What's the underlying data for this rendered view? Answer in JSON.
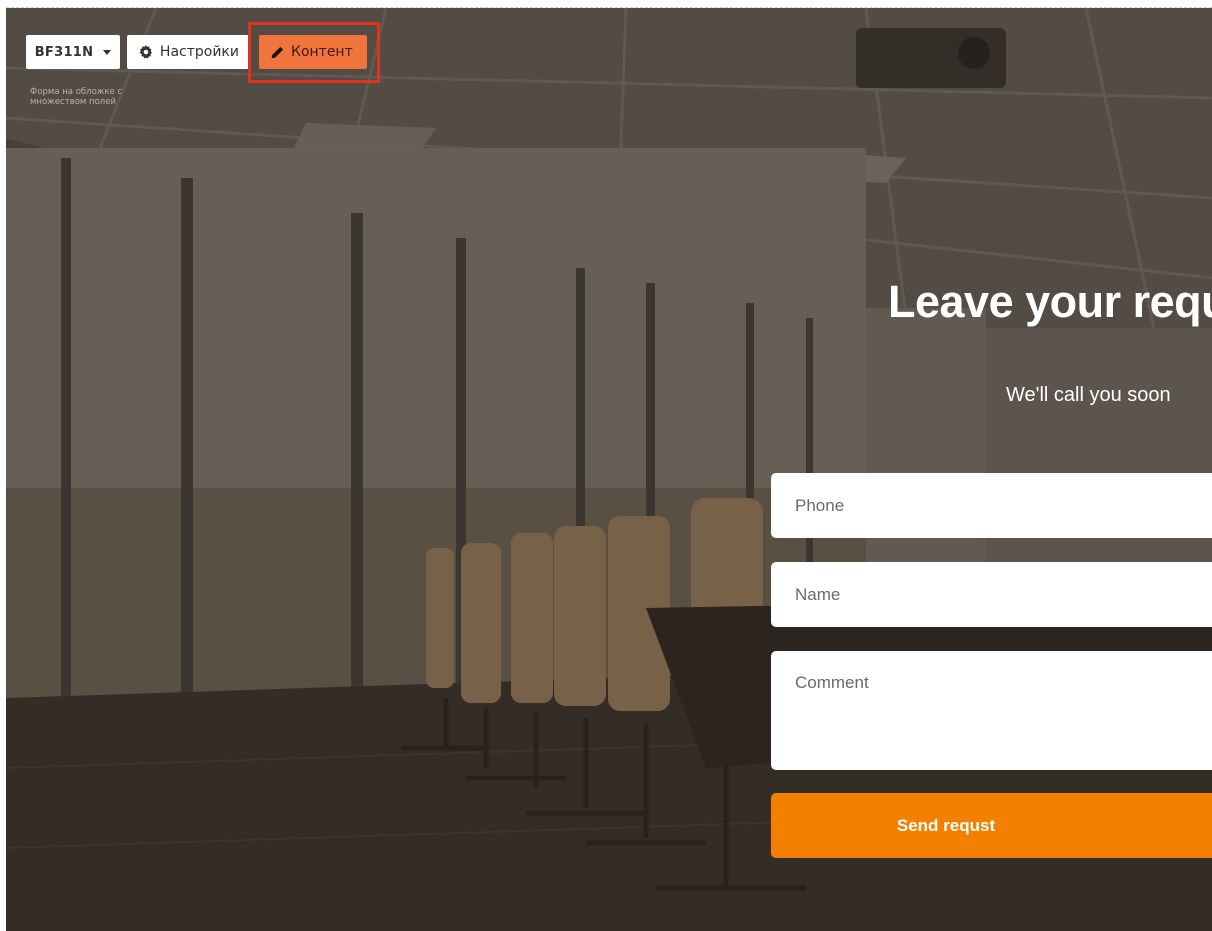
{
  "toolbar": {
    "block_id": "BF311N",
    "settings_label": "Настройки",
    "content_label": "Контент",
    "block_caption": "Форма на обложке с множеством полей"
  },
  "form": {
    "title": "Leave your requ",
    "subtitle": "We'll call you soon",
    "phone_placeholder": "Phone",
    "name_placeholder": "Name",
    "comment_placeholder": "Comment",
    "submit_label": "Send requst"
  },
  "colors": {
    "accent": "#f58000",
    "content_button": "#f2743d",
    "highlight_frame": "#e0331e"
  },
  "icons": [
    "caret-down-icon",
    "gear-icon",
    "pencil-icon"
  ]
}
